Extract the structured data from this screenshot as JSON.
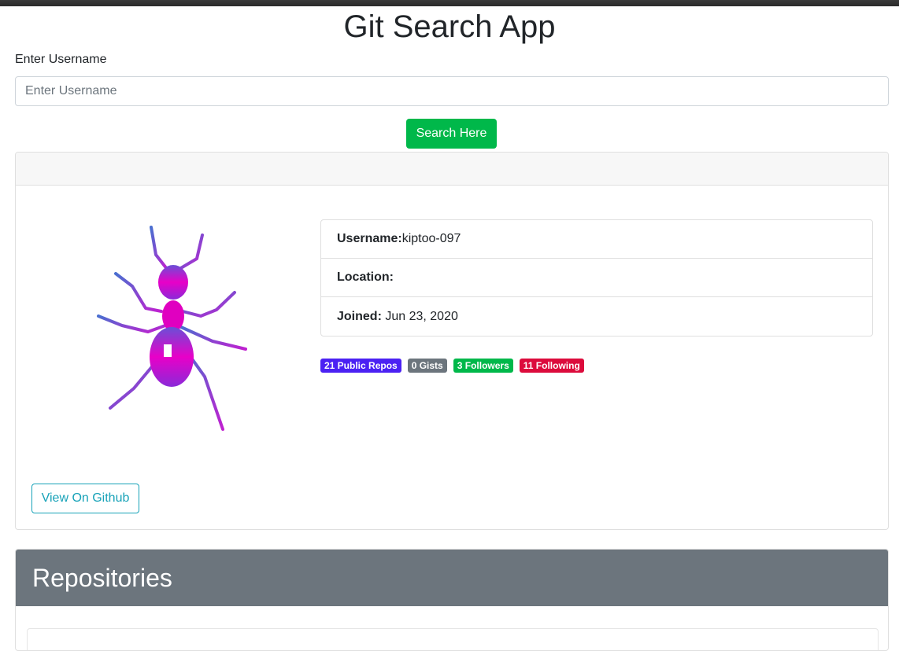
{
  "app": {
    "title": "Git Search App"
  },
  "search": {
    "label": "Enter Username",
    "placeholder": "Enter Username",
    "value": "",
    "button_label": "Search Here"
  },
  "profile": {
    "avatar_icon": "ant-icon",
    "info": [
      {
        "key": "Username:",
        "value": "kiptoo-097"
      },
      {
        "key": "Location:",
        "value": ""
      },
      {
        "key": "Joined:",
        "value": " Jun 23, 2020"
      }
    ],
    "badges": [
      {
        "label": "21 Public Repos",
        "color": "#4b21f3"
      },
      {
        "label": "0 Gists",
        "color": "#6c757d"
      },
      {
        "label": "3 Followers",
        "color": "#00b84a"
      },
      {
        "label": "11 Following",
        "color": "#dc0b3c"
      }
    ],
    "github_button_label": "View On Github"
  },
  "repositories": {
    "title": "Repositories"
  },
  "colors": {
    "primary_green": "#00b84a",
    "info_teal": "#17a2b8",
    "header_gray": "#6c757d"
  }
}
